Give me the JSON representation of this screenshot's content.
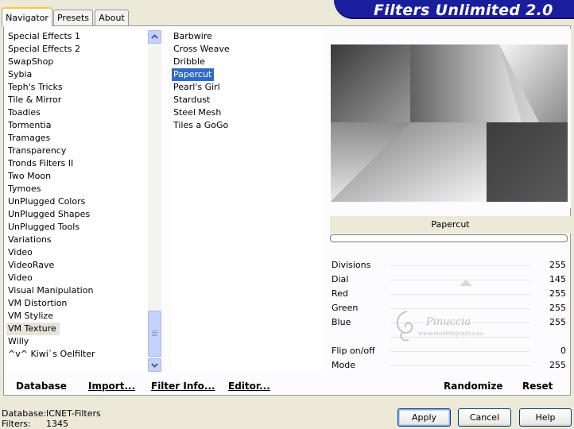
{
  "tabs": [
    {
      "label": "Navigator",
      "active": true
    },
    {
      "label": "Presets",
      "active": false
    },
    {
      "label": "About",
      "active": false
    }
  ],
  "banner": {
    "title": "Filters Unlimited 2.0"
  },
  "categories": [
    "Special Effects 1",
    "Special Effects 2",
    "SwapShop",
    "Sybia",
    "Teph's Tricks",
    "Tile & Mirror",
    "Toadies",
    "Tormentia",
    "Tramages",
    "Transparency",
    "Tronds Filters II",
    "Two Moon",
    "Tymoes",
    "UnPlugged Colors",
    "UnPlugged Shapes",
    "UnPlugged Tools",
    "Variations",
    "Video",
    "VideoRave",
    "Video",
    "Visual Manipulation",
    "VM Distortion",
    "VM Stylize",
    "VM Texture",
    "Willy",
    "^v^ Kiwi`s Oelfilter"
  ],
  "selected_category": "VM Texture",
  "filters": [
    "Barbwire",
    "Cross Weave",
    "Dribble",
    "Papercut",
    "Pearl's Girl",
    "Stardust",
    "Steel Mesh",
    "Tiles a GoGo"
  ],
  "selected_filter": "Papercut",
  "preview": {
    "filter_name": "Papercut",
    "progress": 0
  },
  "params": [
    {
      "name": "Divisions",
      "value": "255"
    },
    {
      "name": "Dial",
      "value": "145"
    },
    {
      "name": "Red",
      "value": "255"
    },
    {
      "name": "Green",
      "value": "255"
    },
    {
      "name": "Blue",
      "value": "255"
    },
    {
      "name": "",
      "value": ""
    },
    {
      "name": "Flip on/off",
      "value": "0"
    },
    {
      "name": "Mode",
      "value": "255"
    }
  ],
  "watermark": {
    "name": "Pinuccia",
    "url": "www.maidiragrafica.eu"
  },
  "commands": {
    "database": "Database",
    "import": "Import...",
    "filter_info": "Filter Info...",
    "editor": "Editor...",
    "randomize": "Randomize",
    "reset": "Reset"
  },
  "status": {
    "database_label": "Database:",
    "database_value": "ICNET-Filters",
    "filters_label": "Filters:",
    "filters_value": "1345"
  },
  "buttons": {
    "apply": "Apply",
    "cancel": "Cancel",
    "help": "Help"
  },
  "colors": {
    "selection_blue": "#316ac5",
    "banner_blue": "#1a1e9c",
    "dialog_bg": "#ece9d8"
  }
}
